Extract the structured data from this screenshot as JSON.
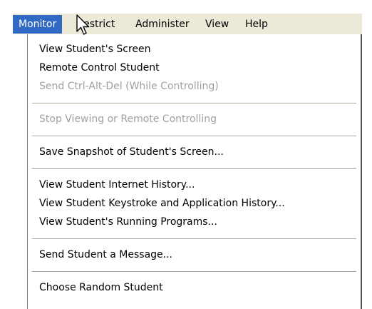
{
  "menubar": {
    "items": [
      {
        "label": "Monitor",
        "open": true
      },
      {
        "label": "Restrict"
      },
      {
        "label": "Administer"
      },
      {
        "label": "View"
      },
      {
        "label": "Help"
      }
    ]
  },
  "monitor_menu": {
    "items": [
      {
        "label": "View Student's Screen",
        "enabled": true
      },
      {
        "label": "Remote Control Student",
        "enabled": true
      },
      {
        "label": "Send Ctrl-Alt-Del (While Controlling)",
        "enabled": false
      },
      {
        "label": "Stop Viewing or Remote Controlling",
        "enabled": false
      },
      {
        "label": "Save Snapshot of Student's Screen...",
        "enabled": true
      },
      {
        "label": "View Student Internet History...",
        "enabled": true
      },
      {
        "label": "View Student Keystroke and Application History...",
        "enabled": true
      },
      {
        "label": "View Student's Running Programs...",
        "enabled": true
      },
      {
        "label": "Send Student a Message...",
        "enabled": true
      },
      {
        "label": "Choose Random Student",
        "enabled": true
      }
    ]
  },
  "colors": {
    "menubar_bg": "#ece9d8",
    "highlight": "#316ac5",
    "disabled_text": "#a0a0a0"
  },
  "icons": {
    "cursor": "arrow-cursor-icon"
  }
}
